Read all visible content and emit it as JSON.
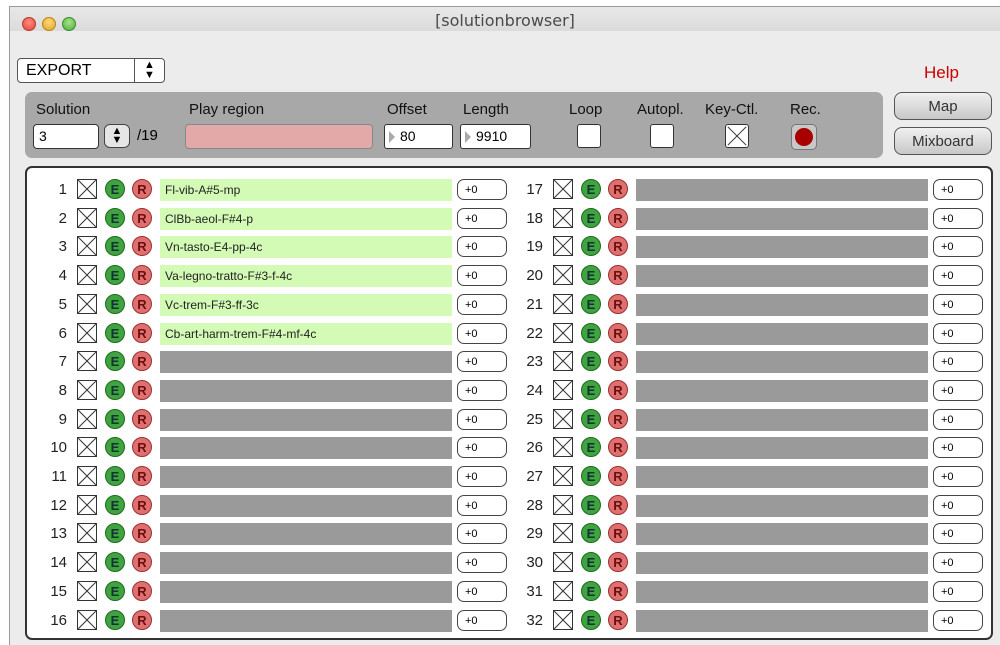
{
  "window": {
    "title": "[solutionbrowser]"
  },
  "mode_select": {
    "value": "EXPORT"
  },
  "help_label": "Help",
  "controls": {
    "solution_label": "Solution",
    "solution_value": "3",
    "solution_total": "/19",
    "play_region_label": "Play region",
    "offset_label": "Offset",
    "offset_value": "80",
    "length_label": "Length",
    "length_value": "9910",
    "loop_label": "Loop",
    "loop_checked": false,
    "autoplay_label": "Autopl.",
    "autoplay_checked": false,
    "keyctl_label": "Key-Ctl.",
    "keyctl_checked": true,
    "rec_label": "Rec.",
    "rec_color": "#a80000"
  },
  "buttons": {
    "map": "Map",
    "mixboard": "Mixboard"
  },
  "colors": {
    "filled_slot": "#d4fbb5",
    "empty_slot": "#9a9a9a",
    "e_button": "#3fa33f",
    "r_button": "#e07070",
    "help": "#cc0000"
  },
  "rows": [
    {
      "num": "1",
      "e": "E",
      "r": "R",
      "name": "Fl-vib-A#5-mp",
      "offset": "+0"
    },
    {
      "num": "2",
      "e": "E",
      "r": "R",
      "name": "ClBb-aeol-F#4-p",
      "offset": "+0"
    },
    {
      "num": "3",
      "e": "E",
      "r": "R",
      "name": "Vn-tasto-E4-pp-4c",
      "offset": "+0"
    },
    {
      "num": "4",
      "e": "E",
      "r": "R",
      "name": "Va-legno-tratto-F#3-f-4c",
      "offset": "+0"
    },
    {
      "num": "5",
      "e": "E",
      "r": "R",
      "name": "Vc-trem-F#3-ff-3c",
      "offset": "+0"
    },
    {
      "num": "6",
      "e": "E",
      "r": "R",
      "name": "Cb-art-harm-trem-F#4-mf-4c",
      "offset": "+0"
    },
    {
      "num": "7",
      "e": "E",
      "r": "R",
      "name": "",
      "offset": "+0"
    },
    {
      "num": "8",
      "e": "E",
      "r": "R",
      "name": "",
      "offset": "+0"
    },
    {
      "num": "9",
      "e": "E",
      "r": "R",
      "name": "",
      "offset": "+0"
    },
    {
      "num": "10",
      "e": "E",
      "r": "R",
      "name": "",
      "offset": "+0"
    },
    {
      "num": "11",
      "e": "E",
      "r": "R",
      "name": "",
      "offset": "+0"
    },
    {
      "num": "12",
      "e": "E",
      "r": "R",
      "name": "",
      "offset": "+0"
    },
    {
      "num": "13",
      "e": "E",
      "r": "R",
      "name": "",
      "offset": "+0"
    },
    {
      "num": "14",
      "e": "E",
      "r": "R",
      "name": "",
      "offset": "+0"
    },
    {
      "num": "15",
      "e": "E",
      "r": "R",
      "name": "",
      "offset": "+0"
    },
    {
      "num": "16",
      "e": "E",
      "r": "R",
      "name": "",
      "offset": "+0"
    },
    {
      "num": "17",
      "e": "E",
      "r": "R",
      "name": "",
      "offset": "+0"
    },
    {
      "num": "18",
      "e": "E",
      "r": "R",
      "name": "",
      "offset": "+0"
    },
    {
      "num": "19",
      "e": "E",
      "r": "R",
      "name": "",
      "offset": "+0"
    },
    {
      "num": "20",
      "e": "E",
      "r": "R",
      "name": "",
      "offset": "+0"
    },
    {
      "num": "21",
      "e": "E",
      "r": "R",
      "name": "",
      "offset": "+0"
    },
    {
      "num": "22",
      "e": "E",
      "r": "R",
      "name": "",
      "offset": "+0"
    },
    {
      "num": "23",
      "e": "E",
      "r": "R",
      "name": "",
      "offset": "+0"
    },
    {
      "num": "24",
      "e": "E",
      "r": "R",
      "name": "",
      "offset": "+0"
    },
    {
      "num": "25",
      "e": "E",
      "r": "R",
      "name": "",
      "offset": "+0"
    },
    {
      "num": "26",
      "e": "E",
      "r": "R",
      "name": "",
      "offset": "+0"
    },
    {
      "num": "27",
      "e": "E",
      "r": "R",
      "name": "",
      "offset": "+0"
    },
    {
      "num": "28",
      "e": "E",
      "r": "R",
      "name": "",
      "offset": "+0"
    },
    {
      "num": "29",
      "e": "E",
      "r": "R",
      "name": "",
      "offset": "+0"
    },
    {
      "num": "30",
      "e": "E",
      "r": "R",
      "name": "",
      "offset": "+0"
    },
    {
      "num": "31",
      "e": "E",
      "r": "R",
      "name": "",
      "offset": "+0"
    },
    {
      "num": "32",
      "e": "E",
      "r": "R",
      "name": "",
      "offset": "+0"
    }
  ]
}
